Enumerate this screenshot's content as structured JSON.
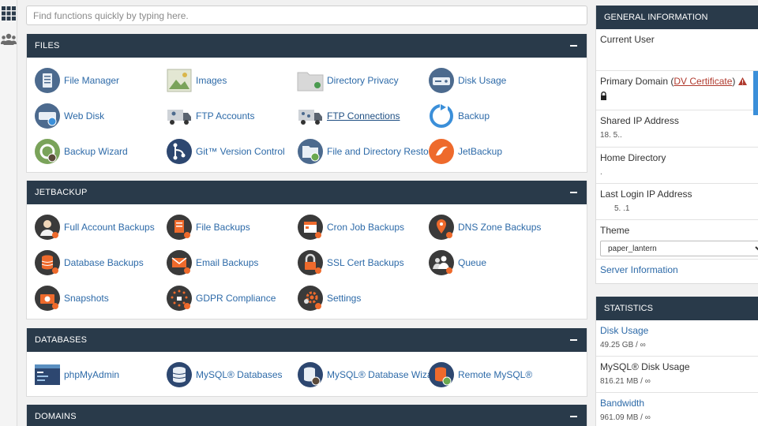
{
  "search": {
    "placeholder": "Find functions quickly by typing here."
  },
  "panels": {
    "files": {
      "title": "FILES",
      "items": [
        {
          "label": "File Manager",
          "icon": "file-manager-icon"
        },
        {
          "label": "Images",
          "icon": "images-icon"
        },
        {
          "label": "Directory Privacy",
          "icon": "directory-privacy-icon"
        },
        {
          "label": "Disk Usage",
          "icon": "disk-usage-icon"
        },
        {
          "label": "Web Disk",
          "icon": "web-disk-icon"
        },
        {
          "label": "FTP Accounts",
          "icon": "ftp-accounts-icon"
        },
        {
          "label": "FTP Connections",
          "icon": "ftp-connections-icon"
        },
        {
          "label": "Backup",
          "icon": "backup-icon"
        },
        {
          "label": "Backup Wizard",
          "icon": "backup-wizard-icon"
        },
        {
          "label": "Git™ Version Control",
          "icon": "git-icon"
        },
        {
          "label": "File and Directory Restoration",
          "icon": "file-restoration-icon"
        },
        {
          "label": "JetBackup",
          "icon": "jetbackup-icon"
        }
      ]
    },
    "jetbackup": {
      "title": "JETBACKUP",
      "items": [
        {
          "label": "Full Account Backups",
          "icon": "full-account-backups-icon"
        },
        {
          "label": "File Backups",
          "icon": "file-backups-icon"
        },
        {
          "label": "Cron Job Backups",
          "icon": "cron-job-backups-icon"
        },
        {
          "label": "DNS Zone Backups",
          "icon": "dns-zone-backups-icon"
        },
        {
          "label": "Database Backups",
          "icon": "database-backups-icon"
        },
        {
          "label": "Email Backups",
          "icon": "email-backups-icon"
        },
        {
          "label": "SSL Cert Backups",
          "icon": "ssl-cert-backups-icon"
        },
        {
          "label": "Queue",
          "icon": "queue-icon"
        },
        {
          "label": "Snapshots",
          "icon": "snapshots-icon"
        },
        {
          "label": "GDPR Compliance",
          "icon": "gdpr-compliance-icon"
        },
        {
          "label": "Settings",
          "icon": "settings-icon"
        }
      ]
    },
    "databases": {
      "title": "DATABASES",
      "items": [
        {
          "label": "phpMyAdmin",
          "icon": "phpmyadmin-icon"
        },
        {
          "label": "MySQL® Databases",
          "icon": "mysql-databases-icon"
        },
        {
          "label": "MySQL® Database Wizard",
          "icon": "mysql-wizard-icon"
        },
        {
          "label": "Remote MySQL®",
          "icon": "remote-mysql-icon"
        }
      ]
    },
    "domains": {
      "title": "DOMAINS"
    }
  },
  "general": {
    "title": "GENERAL INFORMATION",
    "current_user_label": "Current User",
    "primary_domain_label": "Primary Domain (",
    "dv_text": "DV Certificate",
    "primary_domain_close": ")",
    "shared_ip_label": "Shared IP Address",
    "shared_ip_value": "18.    5..",
    "home_dir_label": "Home Directory",
    "home_dir_value": ".",
    "last_login_label": "Last Login IP Address",
    "last_login_value": "5.   .1",
    "theme_label": "Theme",
    "theme_value": "paper_lantern",
    "server_info_link": "Server Information"
  },
  "stats": {
    "title": "STATISTICS",
    "disk_usage_label": "Disk Usage",
    "disk_usage_value": "49.25 GB / ∞",
    "mysql_disk_label": "MySQL® Disk Usage",
    "mysql_disk_value": "816.21 MB / ∞",
    "bandwidth_label": "Bandwidth",
    "bandwidth_value": "961.09 MB / ∞"
  },
  "colors": {
    "header_bg": "#293a4a",
    "link": "#2d6aa8",
    "warning": "#b03a2e",
    "accent_bar": "#3b8fd9"
  }
}
